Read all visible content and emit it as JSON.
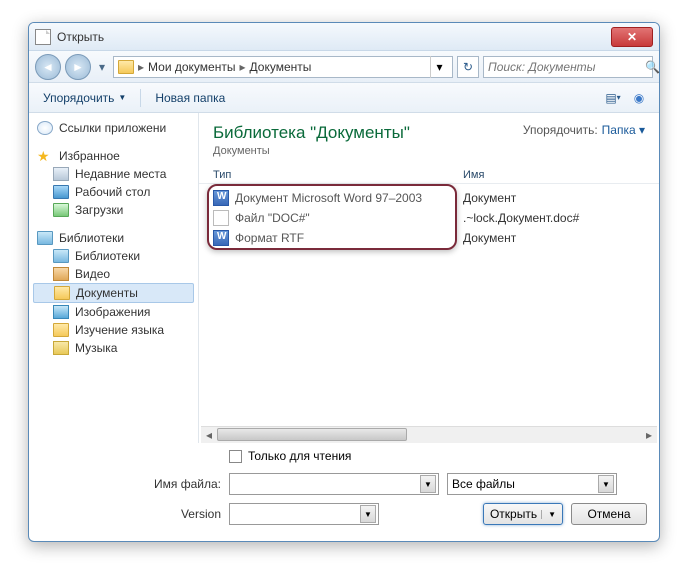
{
  "titlebar": {
    "title": "Открыть"
  },
  "breadcrumb": {
    "items": [
      "Мои документы",
      "Документы"
    ]
  },
  "search": {
    "placeholder": "Поиск: Документы"
  },
  "toolbar": {
    "organize": "Упорядочить",
    "newfolder": "Новая папка"
  },
  "sidebar": {
    "appLinks": "Ссылки приложени",
    "favorites": {
      "label": "Избранное",
      "items": [
        "Недавние места",
        "Рабочий стол",
        "Загрузки"
      ]
    },
    "libraries": {
      "label": "Библиотеки",
      "items": [
        "Библиотеки",
        "Видео",
        "Документы",
        "Изображения",
        "Изучение языка",
        "Музыка"
      ]
    }
  },
  "library": {
    "title": "Библиотека \"Документы\"",
    "subtitle": "Документы",
    "sortLabel": "Упорядочить:",
    "sortValue": "Папка"
  },
  "columns": {
    "type": "Тип",
    "name": "Имя"
  },
  "files": [
    {
      "type": "Документ Microsoft Word 97–2003",
      "name": "Документ",
      "icon": "word"
    },
    {
      "type": "Файл \"DOC#\"",
      "name": ".~lock.Документ.doc#",
      "icon": "blank"
    },
    {
      "type": "Формат RTF",
      "name": "Документ",
      "icon": "word"
    }
  ],
  "options": {
    "readonly": "Только для чтения"
  },
  "form": {
    "filenameLabel": "Имя файла:",
    "filetype": "Все файлы",
    "versionLabel": "Version"
  },
  "buttons": {
    "open": "Открыть",
    "cancel": "Отмена"
  }
}
